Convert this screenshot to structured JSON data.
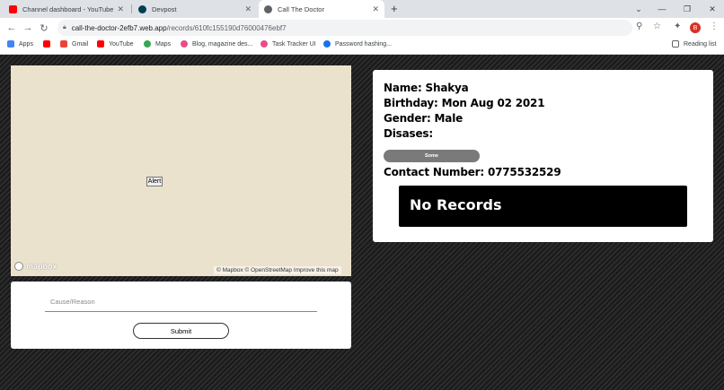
{
  "tabs": [
    {
      "title": "Channel dashboard - YouTube Studio",
      "favicon": "youtube-icon",
      "color": "#ff0000"
    },
    {
      "title": "Devpost",
      "favicon": "devpost-icon",
      "color": "#003e54"
    },
    {
      "title": "Call The Doctor",
      "favicon": "globe-icon",
      "color": "#5f6368"
    }
  ],
  "address": {
    "host": "call-the-doctor-2efb7.web.app",
    "path": "/records/610fc155190d76000476ebf7"
  },
  "profile_initial": "B",
  "bookmarks": [
    {
      "label": "Apps",
      "icon": "apps-grid-icon",
      "color": "#4285f4"
    },
    {
      "label": "",
      "icon": "youtube-icon",
      "color": "#ff0000"
    },
    {
      "label": "Gmail",
      "icon": "gmail-icon",
      "color": "#ea4335"
    },
    {
      "label": "YouTube",
      "icon": "youtube-icon",
      "color": "#ff0000"
    },
    {
      "label": "Maps",
      "icon": "maps-icon",
      "color": "#34a853"
    },
    {
      "label": "Blog, magazine des...",
      "icon": "dribbble-icon",
      "color": "#ea4c89"
    },
    {
      "label": "Task Tracker UI",
      "icon": "dribbble-icon",
      "color": "#ea4c89"
    },
    {
      "label": "Password hashing...",
      "icon": "password-icon",
      "color": "#1a73e8"
    }
  ],
  "reading_list": "Reading list",
  "map": {
    "alert_label": "Alert",
    "logo_text": "mapbox",
    "attribution": "© Mapbox © OpenStreetMap Improve this map"
  },
  "form": {
    "placeholder": "Cause/Reason",
    "value": "",
    "submit_label": "Submit"
  },
  "patient": {
    "name_line": "Name: Shakya",
    "birthday_line": "Birthday: Mon Aug 02 2021",
    "gender_line": "Gender: Male",
    "diseases_line": "Disases:",
    "disease_pill": "Some",
    "contact_line": "Contact Number: 0775532529"
  },
  "records_text": "No Records"
}
